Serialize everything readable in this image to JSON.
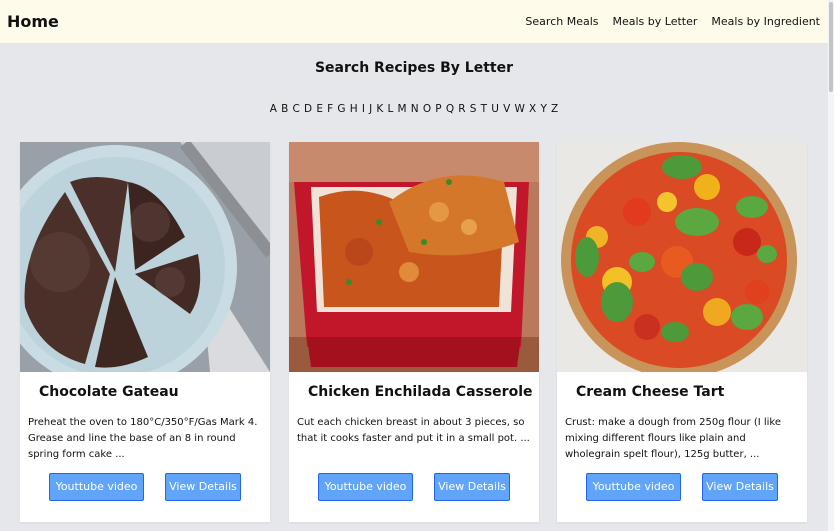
{
  "navbar": {
    "brand": "Home",
    "links": [
      "Search Meals",
      "Meals by Letter",
      "Meals by Ingredient"
    ]
  },
  "page_title": "Search Recipes By Letter",
  "letters": [
    "A",
    "B",
    "C",
    "D",
    "E",
    "F",
    "G",
    "H",
    "I",
    "J",
    "K",
    "L",
    "M",
    "N",
    "O",
    "P",
    "Q",
    "R",
    "S",
    "T",
    "U",
    "V",
    "W",
    "X",
    "Y",
    "Z"
  ],
  "cards": [
    {
      "title": "Chocolate Gateau",
      "description": "Preheat the oven to 180°C/350°F/Gas Mark 4. Grease and line the base of an 8 in round spring form cake ...",
      "youtube_label": "Youttube video",
      "details_label": "View Details",
      "image_icon": "chocolate-cake-image"
    },
    {
      "title": "Chicken Enchilada Casserole",
      "description": "Cut each chicken breast in about 3 pieces, so that it cooks faster and put it in a small pot. ...",
      "youtube_label": "Youttube video",
      "details_label": "View Details",
      "image_icon": "enchilada-casserole-image"
    },
    {
      "title": "Cream Cheese Tart",
      "description": "Crust: make a dough from 250g flour (I like mixing different flours like plain and wholegrain spelt flour), 125g butter, ...",
      "youtube_label": "Youttube video",
      "details_label": "View Details",
      "image_icon": "tomato-tart-image"
    }
  ],
  "colors": {
    "navbar_bg": "#fffbeb",
    "page_bg": "#e5e7eb",
    "button_bg": "#60a5fa",
    "button_border": "#2563eb"
  }
}
